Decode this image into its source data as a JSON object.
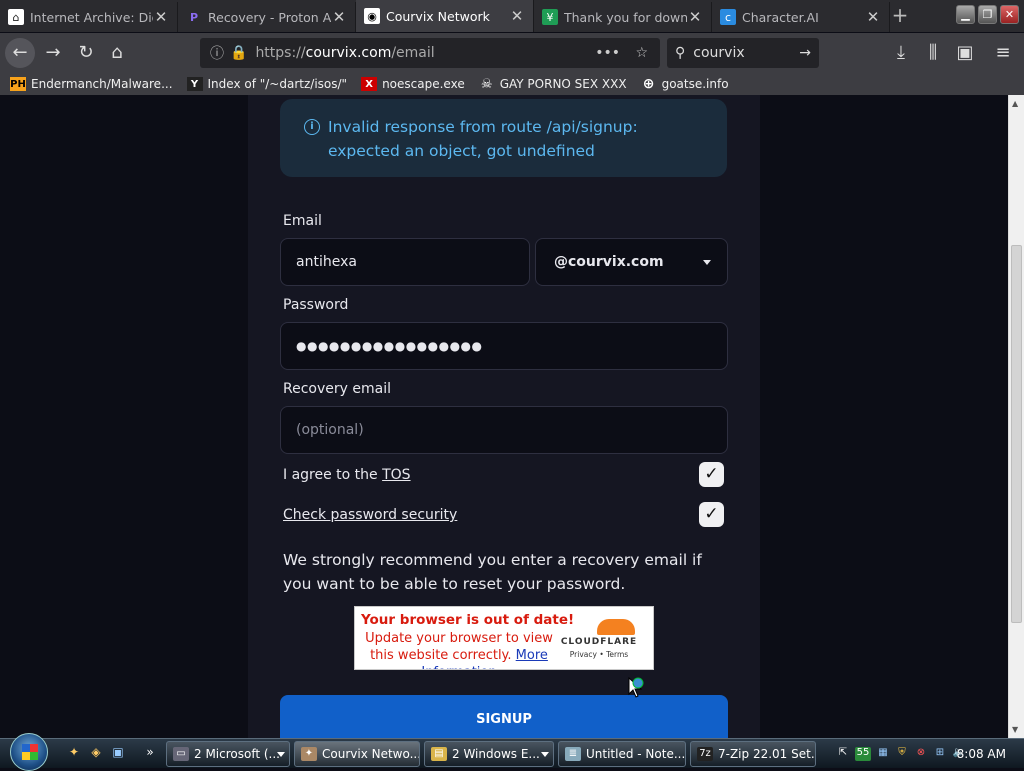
{
  "browser": {
    "tabs": [
      {
        "title": "Internet Archive: Digi",
        "icon": "archive-icon",
        "active": false
      },
      {
        "title": "Recovery - Proton Ac",
        "icon": "proton-icon",
        "active": false
      },
      {
        "title": "Courvix Network",
        "icon": "courvix-icon",
        "active": true
      },
      {
        "title": "Thank you for downl",
        "icon": "download-icon",
        "active": false
      },
      {
        "title": "Character.AI",
        "icon": "character-ai-icon",
        "active": false
      }
    ],
    "url_prefix": "https://",
    "url_domain": "courvix.com",
    "url_path": "/email",
    "search_value": "courvix",
    "bookmarks": [
      {
        "label": "Endermanch/Malware...",
        "icon": "ph-icon",
        "badge": "PH"
      },
      {
        "label": "Index of \"/~dartz/isos/\"",
        "icon": "yc-icon",
        "badge": "Y"
      },
      {
        "label": "noescape.exe",
        "icon": "x-red-icon",
        "badge": "X"
      },
      {
        "label": "GAY PORNO SEX XXX",
        "icon": "skull-icon",
        "badge": "☠"
      },
      {
        "label": "goatse.info",
        "icon": "globe-icon",
        "badge": "⊕"
      }
    ]
  },
  "form": {
    "alert": "Invalid response from route /api/signup: expected an object, got undefined",
    "email_label": "Email",
    "email_value": "antihexa",
    "domain_value": "@courvix.com",
    "password_label": "Password",
    "password_value": "●●●●●●●●●●●●●●●●●",
    "recovery_label": "Recovery email",
    "recovery_placeholder": "(optional)",
    "tos_prefix": "I agree to the ",
    "tos_link": "TOS",
    "tos_checked": true,
    "security_link": "Check password security",
    "security_checked": true,
    "note": "We strongly recommend you enter a recovery email if you want to be able to reset your password.",
    "cloudflare": {
      "title": "Your browser is out of date!",
      "body": "Update your browser to view this website correctly.",
      "more": "More Information",
      "brand": "CLOUDFLARE",
      "links": "Privacy • Terms"
    },
    "signup_label": "SIGNUP"
  },
  "taskbar": {
    "items": [
      {
        "label": "2 Microsoft (...",
        "icon": "window-icon",
        "dropdown": true
      },
      {
        "label": "Courvix Netwo...",
        "icon": "browser-icon",
        "dropdown": false,
        "active": true
      },
      {
        "label": "2 Windows E...",
        "icon": "folder-icon",
        "dropdown": true
      },
      {
        "label": "Untitled - Note...",
        "icon": "notepad-icon",
        "dropdown": false
      },
      {
        "label": "7-Zip 22.01 Set...",
        "icon": "7zip-icon",
        "dropdown": false
      }
    ],
    "tray_badge": "55",
    "clock": "8:08 AM"
  }
}
